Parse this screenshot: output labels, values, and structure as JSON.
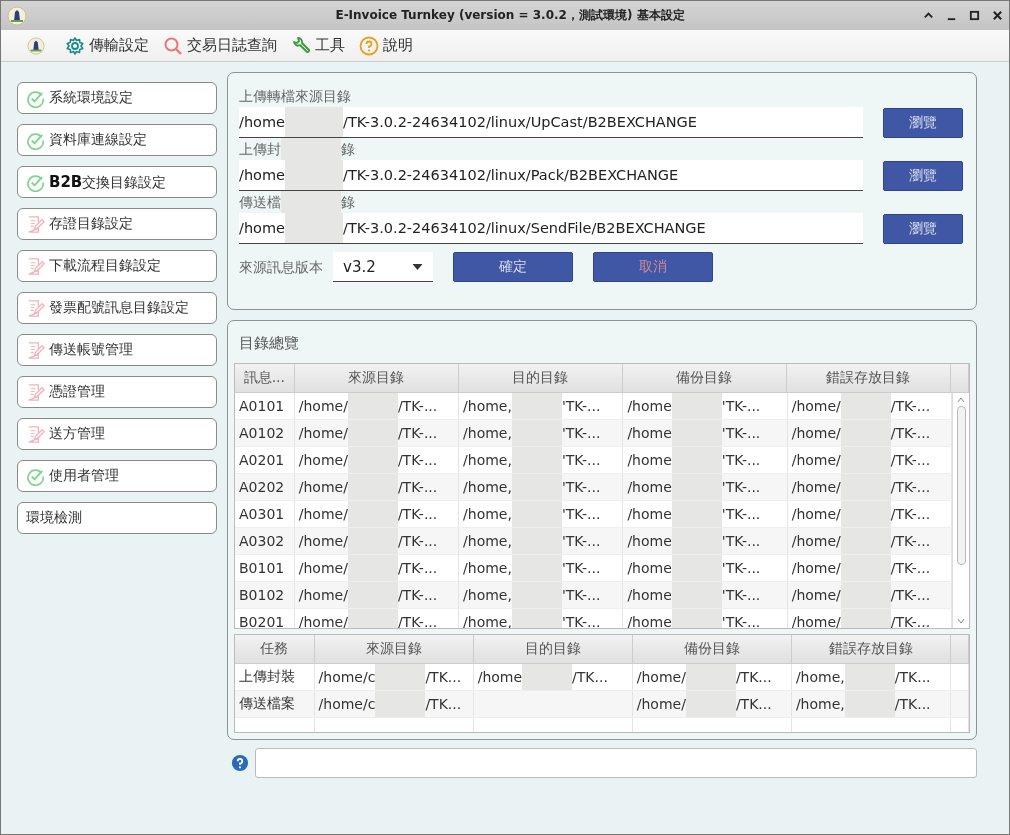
{
  "window": {
    "title": "E-Invoice Turnkey (version = 3.0.2，測試環境) 基本設定"
  },
  "menu": [
    {
      "label": "傳輸設定",
      "kind": "gear"
    },
    {
      "label": "交易日誌查詢",
      "kind": "search"
    },
    {
      "label": "工具",
      "kind": "wrench"
    },
    {
      "label": "說明",
      "kind": "help"
    }
  ],
  "sidebar": {
    "items": [
      {
        "label": "系統環境設定",
        "kind": "done"
      },
      {
        "label": "資料庫連線設定",
        "kind": "done"
      },
      {
        "label": "**B2B**交換目錄設定",
        "kind": "done"
      },
      {
        "label": "存證目錄設定",
        "kind": "todo"
      },
      {
        "label": "下載流程目錄設定",
        "kind": "todo"
      },
      {
        "label": "發票配號訊息目錄設定",
        "kind": "todo"
      },
      {
        "label": "傳送帳號管理",
        "kind": "todo"
      },
      {
        "label": "憑證管理",
        "kind": "todo"
      },
      {
        "label": "送方管理",
        "kind": "todo"
      },
      {
        "label": "使用者管理",
        "kind": "done"
      },
      {
        "label": "環境檢測",
        "kind": "plain"
      }
    ]
  },
  "directories": {
    "fields": [
      {
        "label": "上傳轉檔來源目錄",
        "value_head": "/home",
        "value_tail": "/TK-3.0.2-24634102/linux/UpCast/B2BEXCHANGE",
        "button": "瀏覽"
      },
      {
        "label": "上傳封",
        "label_tail": "錄",
        "value_head": "/home",
        "value_tail": "/TK-3.0.2-24634102/linux/Pack/B2BEXCHANGE",
        "button": "瀏覽"
      },
      {
        "label": "傳送檔",
        "label_tail": "錄",
        "value_head": "/home",
        "value_tail": "/TK-3.0.2-24634102/linux/SendFile/B2BEXCHANGE",
        "button": "瀏覽"
      }
    ],
    "version_label": "來源訊息版本",
    "version": "v3.2",
    "buttons": [
      {
        "label": "確定",
        "kind": "confirm"
      },
      {
        "label": "取消",
        "kind": "cancel"
      }
    ]
  },
  "overview": {
    "title": "目錄總覽",
    "table": {
      "columns": [
        "訊息...",
        "來源目錄",
        "目的目錄",
        "備份目錄",
        "錯誤存放目錄"
      ],
      "rows": [
        {
          "cells": [
            {
              "text": "A0101"
            },
            {
              "text": "/home/",
              "tail": "/TK-..."
            },
            {
              "text": "/home,",
              "tail": "'TK-..."
            },
            {
              "text": "/home",
              "tail": "'TK-..."
            },
            {
              "text": "/home/",
              "tail": "/TK-..."
            }
          ]
        },
        {
          "cells": [
            {
              "text": "A0102"
            },
            {
              "text": "/home/",
              "tail": "/TK-..."
            },
            {
              "text": "/home,",
              "tail": "'TK-..."
            },
            {
              "text": "/home",
              "tail": "'TK-..."
            },
            {
              "text": "/home/",
              "tail": "/TK-..."
            }
          ]
        },
        {
          "cells": [
            {
              "text": "A0201"
            },
            {
              "text": "/home/",
              "tail": "/TK-..."
            },
            {
              "text": "/home,",
              "tail": "'TK-..."
            },
            {
              "text": "/home",
              "tail": "'TK-..."
            },
            {
              "text": "/home/",
              "tail": "/TK-..."
            }
          ]
        },
        {
          "cells": [
            {
              "text": "A0202"
            },
            {
              "text": "/home/",
              "tail": "/TK-..."
            },
            {
              "text": "/home,",
              "tail": "'TK-..."
            },
            {
              "text": "/home",
              "tail": "'TK-..."
            },
            {
              "text": "/home/",
              "tail": "/TK-..."
            }
          ]
        },
        {
          "cells": [
            {
              "text": "A0301"
            },
            {
              "text": "/home/",
              "tail": "/TK-..."
            },
            {
              "text": "/home,",
              "tail": "'TK-..."
            },
            {
              "text": "/home",
              "tail": "'TK-..."
            },
            {
              "text": "/home/",
              "tail": "/TK-..."
            }
          ]
        },
        {
          "cells": [
            {
              "text": "A0302"
            },
            {
              "text": "/home/",
              "tail": "/TK-..."
            },
            {
              "text": "/home,",
              "tail": "'TK-..."
            },
            {
              "text": "/home",
              "tail": "'TK-..."
            },
            {
              "text": "/home/",
              "tail": "/TK-..."
            }
          ]
        },
        {
          "cells": [
            {
              "text": "B0101"
            },
            {
              "text": "/home/",
              "tail": "/TK-..."
            },
            {
              "text": "/home,",
              "tail": "'TK-..."
            },
            {
              "text": "/home",
              "tail": "'TK-..."
            },
            {
              "text": "/home/",
              "tail": "/TK-..."
            }
          ]
        },
        {
          "cells": [
            {
              "text": "B0102"
            },
            {
              "text": "/home/",
              "tail": "/TK-..."
            },
            {
              "text": "/home,",
              "tail": "'TK-..."
            },
            {
              "text": "/home",
              "tail": "'TK-..."
            },
            {
              "text": "/home/",
              "tail": "/TK-..."
            }
          ]
        },
        {
          "cells": [
            {
              "text": "B0201"
            },
            {
              "text": "/home/",
              "tail": "/TK-..."
            },
            {
              "text": "/home,",
              "tail": "'TK-..."
            },
            {
              "text": "/home",
              "tail": "'TK-..."
            },
            {
              "text": "/home/",
              "tail": "/TK-..."
            }
          ]
        }
      ]
    },
    "tasks": {
      "columns": [
        "任務",
        "來源目錄",
        "目的目錄",
        "備份目錄",
        "錯誤存放目錄"
      ],
      "rows": [
        {
          "cells": [
            {
              "text": "上傳封裝"
            },
            {
              "text": "/home/c",
              "tail": "/TK..."
            },
            {
              "text": "/home",
              "tail": "/TK..."
            },
            {
              "text": "/home/",
              "tail": "/TK..."
            },
            {
              "text": "/home,",
              "tail": "/TK..."
            }
          ]
        },
        {
          "cells": [
            {
              "text": "傳送檔案"
            },
            {
              "text": "/home/c",
              "tail": "/TK..."
            },
            null,
            {
              "text": "/home/",
              "tail": "/TK..."
            },
            {
              "text": "/home,",
              "tail": "/TK..."
            }
          ]
        }
      ]
    }
  }
}
